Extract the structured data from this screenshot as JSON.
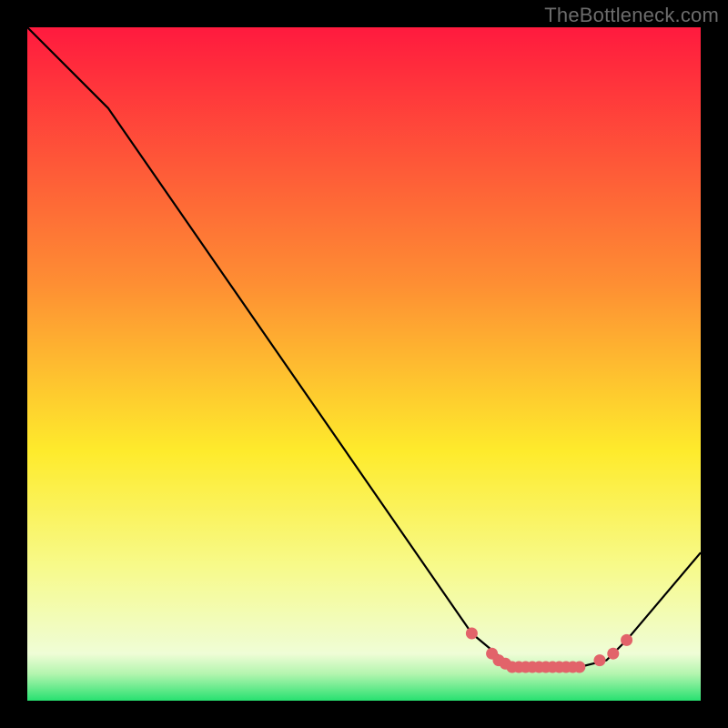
{
  "watermark": "TheBottleneck.com",
  "colors": {
    "frame": "#000000",
    "line": "#000000",
    "marker": "#E2636A",
    "bg_top": "#FF1A3E",
    "bg_mid1": "#FE8E33",
    "bg_mid2": "#FEEB2C",
    "bg_mid3": "#F7FA8A",
    "bg_bottom": "#27E170"
  },
  "chart_data": {
    "type": "line",
    "title": "",
    "xlabel": "",
    "ylabel": "",
    "xlim": [
      0,
      100
    ],
    "ylim": [
      0,
      100
    ],
    "background_gradient_stops": [
      {
        "offset": 0,
        "color": "#FF1A3E"
      },
      {
        "offset": 38,
        "color": "#FE8E33"
      },
      {
        "offset": 63,
        "color": "#FEEB2C"
      },
      {
        "offset": 80,
        "color": "#F7FA8A"
      },
      {
        "offset": 93,
        "color": "#EFFDD6"
      },
      {
        "offset": 96,
        "color": "#B4F5AF"
      },
      {
        "offset": 100,
        "color": "#27E170"
      }
    ],
    "series": [
      {
        "name": "bottleneck-curve",
        "x": [
          0,
          12,
          66,
          72,
          82,
          86,
          89,
          100
        ],
        "y": [
          100,
          88,
          10,
          5,
          5,
          6,
          9,
          22
        ]
      }
    ],
    "markers": {
      "name": "optimal-range",
      "points": [
        {
          "x": 66,
          "y": 10
        },
        {
          "x": 69,
          "y": 7
        },
        {
          "x": 70,
          "y": 6
        },
        {
          "x": 71,
          "y": 5.5
        },
        {
          "x": 72,
          "y": 5
        },
        {
          "x": 73,
          "y": 5
        },
        {
          "x": 74,
          "y": 5
        },
        {
          "x": 75,
          "y": 5
        },
        {
          "x": 76,
          "y": 5
        },
        {
          "x": 77,
          "y": 5
        },
        {
          "x": 78,
          "y": 5
        },
        {
          "x": 79,
          "y": 5
        },
        {
          "x": 80,
          "y": 5
        },
        {
          "x": 81,
          "y": 5
        },
        {
          "x": 82,
          "y": 5
        },
        {
          "x": 85,
          "y": 6
        },
        {
          "x": 87,
          "y": 7
        },
        {
          "x": 89,
          "y": 9
        }
      ]
    }
  }
}
